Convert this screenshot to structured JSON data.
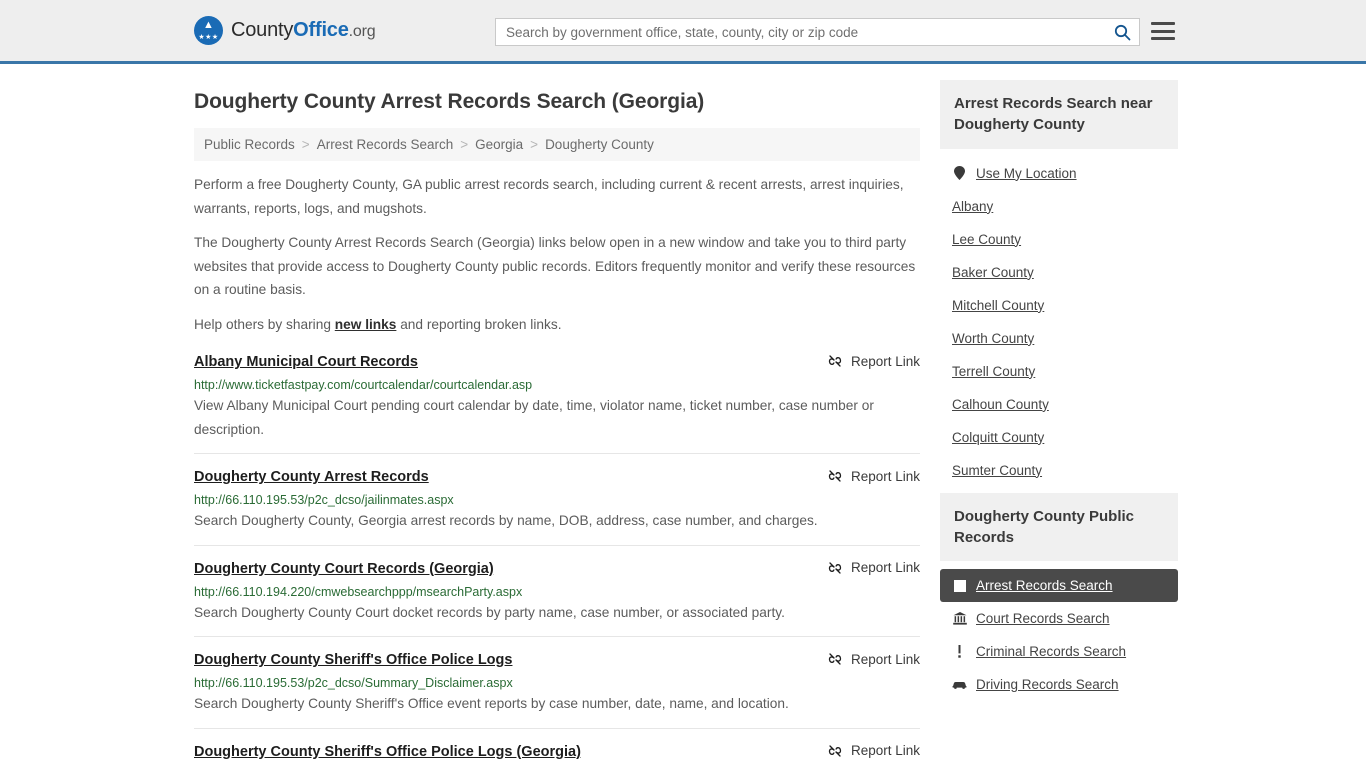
{
  "header": {
    "logo": {
      "part1": "County",
      "part2": "Office",
      "part3": ".org",
      "icon": "eagle-seal-icon"
    },
    "search": {
      "placeholder": "Search by government office, state, county, city or zip code",
      "value": "",
      "icon": "search-icon"
    },
    "menu_icon": "hamburger-menu-icon",
    "accent_color": "#3a76a8"
  },
  "page_title": "Dougherty County Arrest Records Search (Georgia)",
  "breadcrumb": {
    "items": [
      {
        "label": "Public Records"
      },
      {
        "label": "Arrest Records Search"
      },
      {
        "label": "Georgia"
      },
      {
        "label": "Dougherty County"
      }
    ],
    "separator": ">"
  },
  "intro": {
    "p1": "Perform a free Dougherty County, GA public arrest records search, including current & recent arrests, arrest inquiries, warrants, reports, logs, and mugshots.",
    "p2": "The Dougherty County Arrest Records Search (Georgia) links below open in a new window and take you to third party websites that provide access to Dougherty County public records. Editors frequently monitor and verify these resources on a routine basis.",
    "p3_before": "Help others by sharing ",
    "p3_link": "new links",
    "p3_after": " and reporting broken links."
  },
  "report_link_label": "Report Link",
  "report_link_icon": "broken-link-icon",
  "results": [
    {
      "title": "Albany Municipal Court Records",
      "url": "http://www.ticketfastpay.com/courtcalendar/courtcalendar.asp",
      "description": "View Albany Municipal Court pending court calendar by date, time, violator name, ticket number, case number or description."
    },
    {
      "title": "Dougherty County Arrest Records",
      "url": "http://66.110.195.53/p2c_dcso/jailinmates.aspx",
      "description": "Search Dougherty County, Georgia arrest records by name, DOB, address, case number, and charges."
    },
    {
      "title": "Dougherty County Court Records (Georgia)",
      "url": "http://66.110.194.220/cmwebsearchppp/msearchParty.aspx",
      "description": "Search Dougherty County Court docket records by party name, case number, or associated party."
    },
    {
      "title": "Dougherty County Sheriff's Office Police Logs",
      "url": "http://66.110.195.53/p2c_dcso/Summary_Disclaimer.aspx",
      "description": "Search Dougherty County Sheriff's Office event reports by case number, date, name, and location."
    },
    {
      "title": "Dougherty County Sheriff's Office Police Logs (Georgia)",
      "url": "",
      "description": ""
    }
  ],
  "sidebar": {
    "nearby": {
      "title": "Arrest Records Search near Dougherty County",
      "items": [
        {
          "label": "Use My Location",
          "icon": "map-pin-icon",
          "has_icon": true
        },
        {
          "label": "Albany",
          "icon": "",
          "has_icon": false
        },
        {
          "label": "Lee County",
          "icon": "",
          "has_icon": false
        },
        {
          "label": "Baker County",
          "icon": "",
          "has_icon": false
        },
        {
          "label": "Mitchell County",
          "icon": "",
          "has_icon": false
        },
        {
          "label": "Worth County",
          "icon": "",
          "has_icon": false
        },
        {
          "label": "Terrell County",
          "icon": "",
          "has_icon": false
        },
        {
          "label": "Calhoun County",
          "icon": "",
          "has_icon": false
        },
        {
          "label": "Colquitt County",
          "icon": "",
          "has_icon": false
        },
        {
          "label": "Sumter County",
          "icon": "",
          "has_icon": false
        }
      ]
    },
    "public_records": {
      "title": "Dougherty County Public Records",
      "items": [
        {
          "label": "Arrest Records Search",
          "icon": "document-icon",
          "active": true
        },
        {
          "label": "Court Records Search",
          "icon": "courthouse-icon",
          "active": false
        },
        {
          "label": "Criminal Records Search",
          "icon": "exclamation-icon",
          "active": false
        },
        {
          "label": "Driving Records Search",
          "icon": "car-icon",
          "active": false
        }
      ]
    }
  }
}
